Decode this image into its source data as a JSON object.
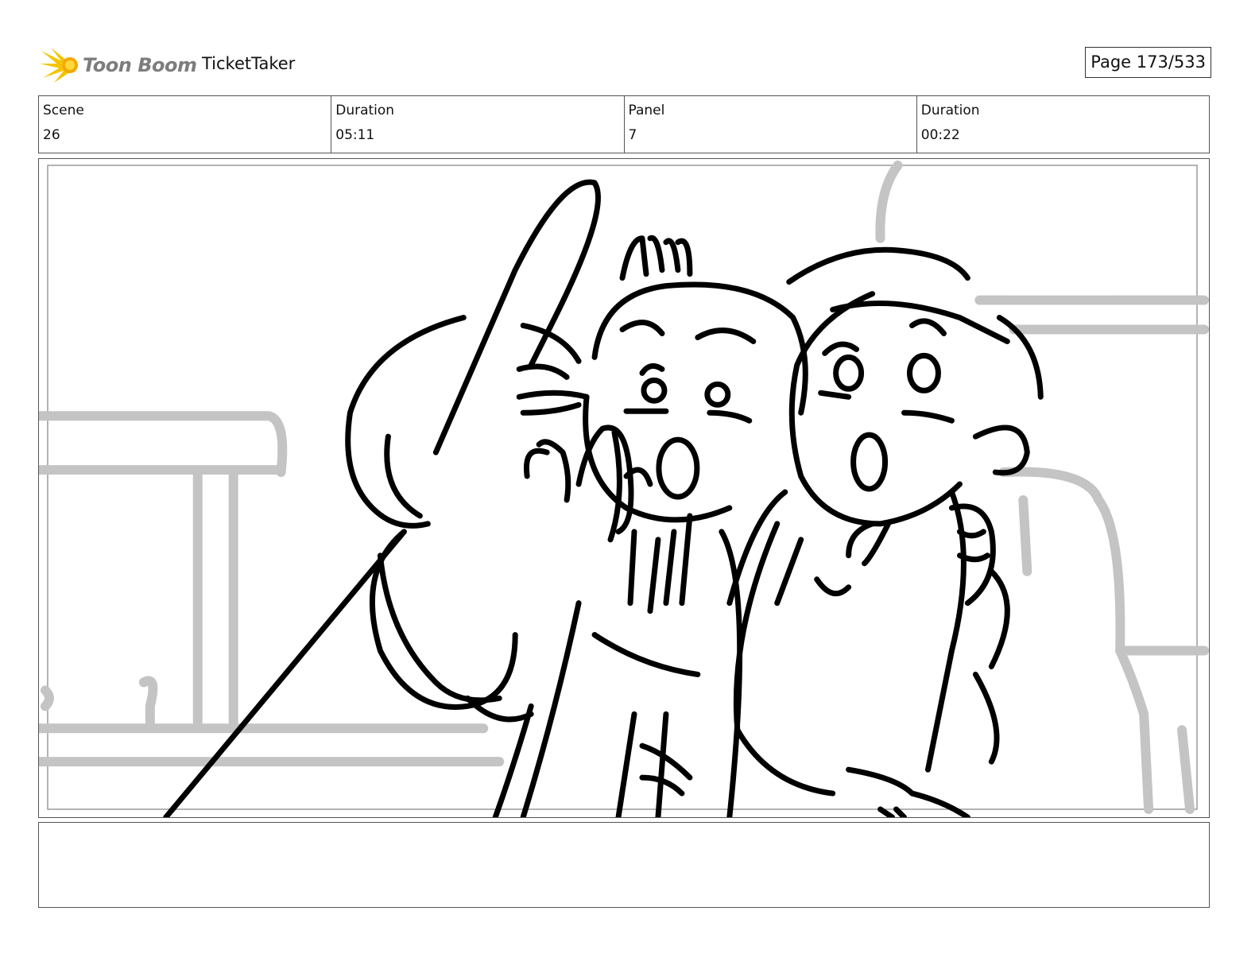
{
  "header": {
    "brand": "Toon Boom",
    "project_title": "TicketTaker",
    "page_counter": "Page 173/533"
  },
  "info": {
    "scene_label": "Scene",
    "scene_value": "26",
    "scene_duration_label": "Duration",
    "scene_duration_value": "05:11",
    "panel_label": "Panel",
    "panel_value": "7",
    "panel_duration_label": "Duration",
    "panel_duration_value": "00:22"
  },
  "colors": {
    "logo_star": "#f5c400",
    "logo_text": "#7d7d7d",
    "border": "#555555",
    "sketch_ink": "#000000",
    "background_sketch": "#c4c4c4"
  },
  "panel_image": {
    "icon": "storyboard-sketch"
  },
  "notes": {
    "text": ""
  }
}
